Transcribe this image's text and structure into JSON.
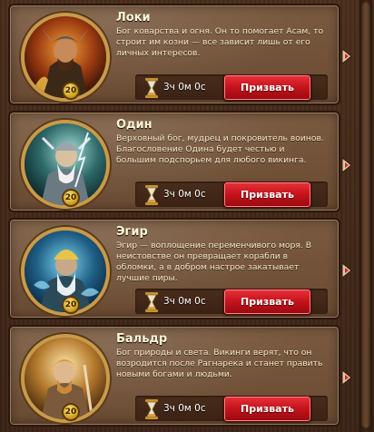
{
  "colors": {
    "summon_button": "#c8141e",
    "card_bg": "#6e4e35",
    "level_badge": "#e3b534",
    "title_text": "#fff6d8"
  },
  "gods": [
    {
      "name": "Локи",
      "description": "Бог коварства и огня. Он то помогает Асам, то строит им козни — все зависит лишь от его личных интересов.",
      "level": "20",
      "timer": "3ч 0м 0с",
      "summon_label": "Призвать",
      "portrait_icon": "loki-portrait-icon"
    },
    {
      "name": "Один",
      "description": "Верховный бог, мудрец и покровитель воинов. Благословение Одина будет честью и большим подспорьем для любого викинга.",
      "level": "20",
      "timer": "3ч 0м 0с",
      "summon_label": "Призвать",
      "portrait_icon": "odin-portrait-icon"
    },
    {
      "name": "Эгир",
      "description": "Эгир — воплощение переменчивого моря. В неистовстве он превращает корабли в обломки, а в добром настрое закатывает лучшие пиры.",
      "level": "20",
      "timer": "3ч 0м 0с",
      "summon_label": "Призвать",
      "portrait_icon": "aegir-portrait-icon"
    },
    {
      "name": "Бальдр",
      "description": "Бог природы и света. Викинги верят, что он возродится после Рагнарека и станет править новыми богами и людьми.",
      "level": "20",
      "timer": "3ч 0м 0с",
      "summon_label": "Призвать",
      "portrait_icon": "baldr-portrait-icon"
    }
  ]
}
